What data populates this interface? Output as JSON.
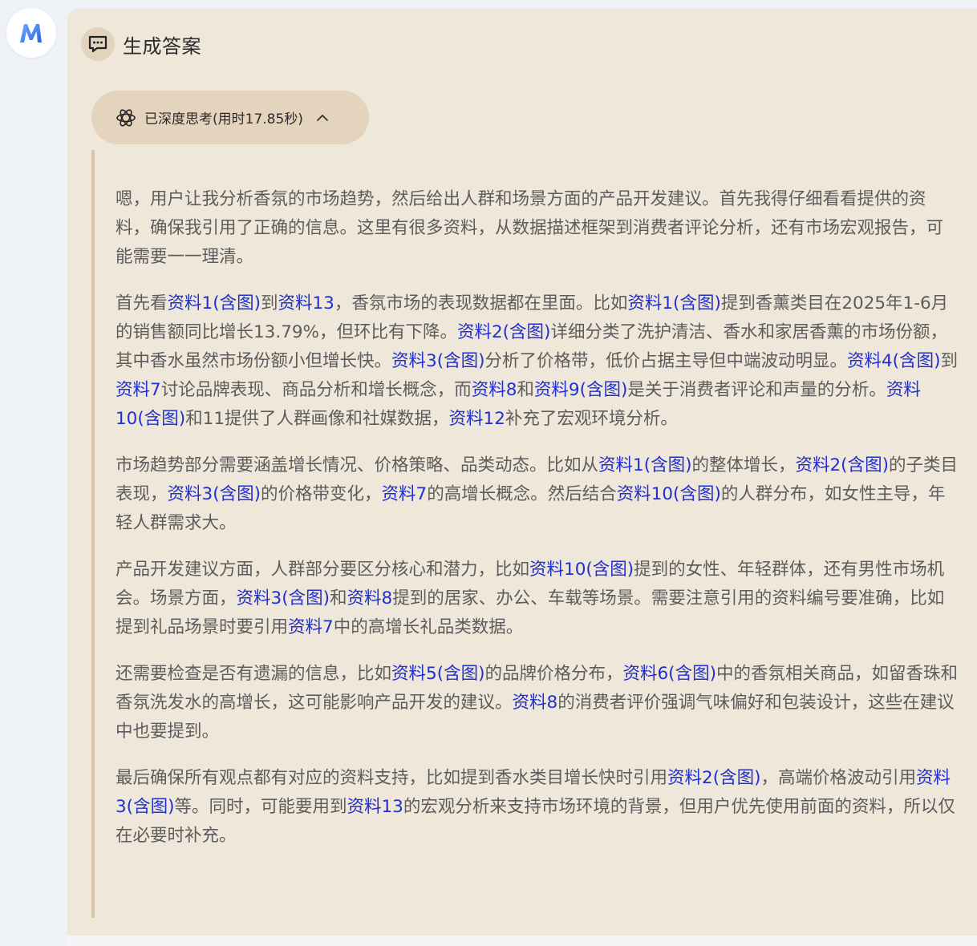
{
  "app": {
    "logo_letter": "M",
    "accent_color": "#4a7ff0"
  },
  "header": {
    "title": "生成答案",
    "icon": "chat-bubble-icon"
  },
  "thinking": {
    "label": "已深度思考(用时17.85秒)",
    "icon": "atom-icon",
    "toggle_icon": "chevron-up-icon"
  },
  "thought": {
    "paragraphs": [
      [
        {
          "t": "嗯，用户让我分析香氛的市场趋势，然后给出人群和场景方面的产品开发建议。首先我得仔细看看提供的资料，确保我引用了正确的信息。这里有很多资料，从数据描述框架到消费者评论分析，还有市场宏观报告，可能需要一一理清。"
        }
      ],
      [
        {
          "t": "首先看"
        },
        {
          "t": "资料1(含图)",
          "ref": true
        },
        {
          "t": "到"
        },
        {
          "t": "资料13",
          "ref": true
        },
        {
          "t": "，香氛市场的表现数据都在里面。比如"
        },
        {
          "t": "资料1(含图)",
          "ref": true
        },
        {
          "t": "提到香薰类目在2025年1-6月的销售额同比增长13.79%，但环比有下降。"
        },
        {
          "t": "资料2(含图)",
          "ref": true
        },
        {
          "t": "详细分类了洗护清洁、香水和家居香薰的市场份额，其中香水虽然市场份额小但增长快。"
        },
        {
          "t": "资料3(含图)",
          "ref": true
        },
        {
          "t": "分析了价格带，低价占据主导但中端波动明显。"
        },
        {
          "t": "资料4(含图)",
          "ref": true
        },
        {
          "t": "到"
        },
        {
          "t": "资料7",
          "ref": true
        },
        {
          "t": "讨论品牌表现、商品分析和增长概念，而"
        },
        {
          "t": "资料8",
          "ref": true
        },
        {
          "t": "和"
        },
        {
          "t": "资料9(含图)",
          "ref": true
        },
        {
          "t": "是关于消费者评论和声量的分析。"
        },
        {
          "t": "资料10(含图)",
          "ref": true
        },
        {
          "t": "和11提供了人群画像和社媒数据，"
        },
        {
          "t": "资料12",
          "ref": true
        },
        {
          "t": "补充了宏观环境分析。"
        }
      ],
      [
        {
          "t": "市场趋势部分需要涵盖增长情况、价格策略、品类动态。比如从"
        },
        {
          "t": "资料1(含图)",
          "ref": true
        },
        {
          "t": "的整体增长，"
        },
        {
          "t": "资料2(含图)",
          "ref": true
        },
        {
          "t": "的子类目表现，"
        },
        {
          "t": "资料3(含图)",
          "ref": true
        },
        {
          "t": "的价格带变化，"
        },
        {
          "t": "资料7",
          "ref": true
        },
        {
          "t": "的高增长概念。然后结合"
        },
        {
          "t": "资料10(含图)",
          "ref": true
        },
        {
          "t": "的人群分布，如女性主导，年轻人群需求大。"
        }
      ],
      [
        {
          "t": "产品开发建议方面，人群部分要区分核心和潜力，比如"
        },
        {
          "t": "资料10(含图)",
          "ref": true
        },
        {
          "t": "提到的女性、年轻群体，还有男性市场机会。场景方面，"
        },
        {
          "t": "资料3(含图)",
          "ref": true
        },
        {
          "t": "和"
        },
        {
          "t": "资料8",
          "ref": true
        },
        {
          "t": "提到的居家、办公、车载等场景。需要注意引用的资料编号要准确，比如提到礼品场景时要引用"
        },
        {
          "t": "资料7",
          "ref": true
        },
        {
          "t": "中的高增长礼品类数据。"
        }
      ],
      [
        {
          "t": "还需要检查是否有遗漏的信息，比如"
        },
        {
          "t": "资料5(含图)",
          "ref": true
        },
        {
          "t": "的品牌价格分布，"
        },
        {
          "t": "资料6(含图)",
          "ref": true
        },
        {
          "t": "中的香氛相关商品，如留香珠和香氛洗发水的高增长，这可能影响产品开发的建议。"
        },
        {
          "t": "资料8",
          "ref": true
        },
        {
          "t": "的消费者评价强调气味偏好和包装设计，这些在建议中也要提到。"
        }
      ],
      [
        {
          "t": "最后确保所有观点都有对应的资料支持，比如提到香水类目增长快时引用"
        },
        {
          "t": "资料2(含图)",
          "ref": true
        },
        {
          "t": "，高端价格波动引用"
        },
        {
          "t": "资料3(含图)",
          "ref": true
        },
        {
          "t": "等。同时，可能要用到"
        },
        {
          "t": "资料13",
          "ref": true
        },
        {
          "t": "的宏观分析来支持市场环境的背景，但用户优先使用前面的资料，所以仅在必要时补充。"
        }
      ]
    ]
  }
}
